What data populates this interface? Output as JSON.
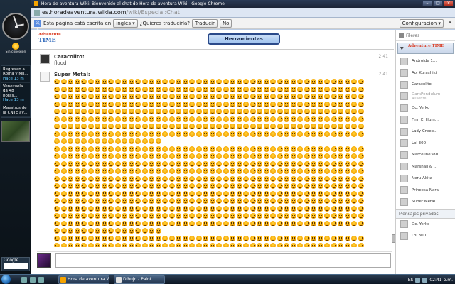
{
  "browser": {
    "window_title": "Hora de aventura Wiki: Bienvenido al chat de Hora de aventura Wiki - Google Chrome",
    "url_host": "es.horadeaventura.wikia.com",
    "url_path": "/wiki/Especial:Chat"
  },
  "translate_bar": {
    "prompt": "Esta página está escrita en",
    "language": "inglés",
    "question": "¿Quieres traducirla?",
    "translate_label": "Traducir",
    "no_label": "No",
    "config_label": "Configuración"
  },
  "vista_sidebar": {
    "weather_label": "Sin conexión",
    "news": [
      {
        "headline": "Regresan a Roma y Mil...",
        "time": "Hace 13 m"
      },
      {
        "headline": "Venezuela da 48 horas...",
        "time": "Hace 13 m"
      },
      {
        "headline": "Maestros de la CNTE av...",
        "time": ""
      }
    ],
    "search_logo": "Google"
  },
  "chat": {
    "wiki_logo_line1": "Adventure",
    "wiki_logo_line2": "TIME",
    "tools_label": "Herramientas",
    "messages": [
      {
        "user": "Caracolito:",
        "text": "flood",
        "time": "2:41"
      },
      {
        "user": "Super Metal:",
        "text": "",
        "time": "2:41"
      }
    ]
  },
  "users_rail": {
    "filter_label": "Fileres",
    "wiki_name": "Adventure TIME",
    "users": [
      {
        "name": "Androide 1...",
        "status": ""
      },
      {
        "name": "Aoi Kurashiki",
        "status": ""
      },
      {
        "name": "Caracolito",
        "status": ""
      },
      {
        "name": "DarkPendulum",
        "status": "Ausente"
      },
      {
        "name": "Dc. Yerko",
        "status": ""
      },
      {
        "name": "Finn El Hum...",
        "status": ""
      },
      {
        "name": "Lady Creep...",
        "status": ""
      },
      {
        "name": "Lol 300",
        "status": ""
      },
      {
        "name": "Marceline380",
        "status": ""
      },
      {
        "name": "Marshall & ...",
        "status": ""
      },
      {
        "name": "Neru Akita",
        "status": ""
      },
      {
        "name": "Princesa Nara",
        "status": ""
      },
      {
        "name": "Super Metal",
        "status": ""
      }
    ],
    "private_header": "Mensajes privados",
    "private_users": [
      {
        "name": "Dc. Yerko"
      },
      {
        "name": "Lol 300"
      }
    ]
  },
  "taskbar": {
    "task_chrome": "Hora de aventura W...",
    "task_paint": "Dibujo - Paint",
    "language": "ES",
    "clock": "02:41 p.m."
  }
}
